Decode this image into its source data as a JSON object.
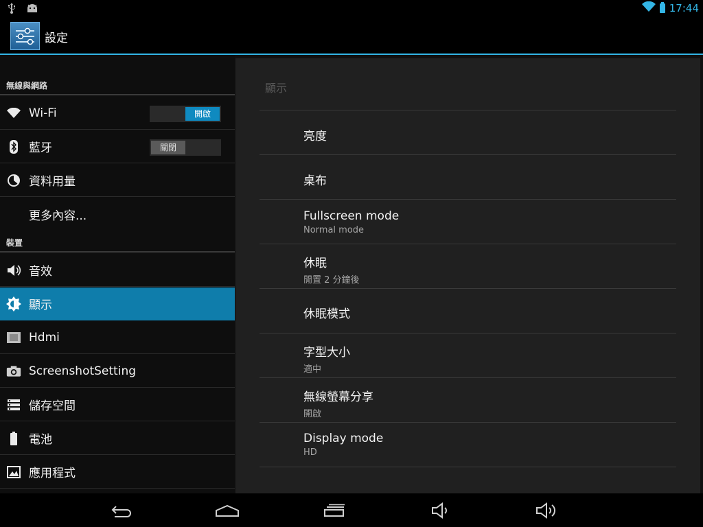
{
  "status_bar": {
    "time": "17:44",
    "left_icons": [
      "usb-icon",
      "android-debug-icon"
    ],
    "right_icons": [
      "wifi-icon",
      "battery-icon"
    ],
    "accent": "#33b5e5"
  },
  "action_bar": {
    "title": "設定",
    "icon": "settings-sliders-icon"
  },
  "sidebar": {
    "sections": [
      {
        "header": "無線與網路"
      },
      {
        "header": "裝置"
      }
    ],
    "items": [
      {
        "label": "Wi-Fi",
        "icon": "wifi-icon",
        "toggle": "開啟",
        "toggle_state": "on"
      },
      {
        "label": "藍牙",
        "icon": "bluetooth-icon",
        "toggle": "關閉",
        "toggle_state": "off"
      },
      {
        "label": "資料用量",
        "icon": "data-usage-icon"
      },
      {
        "label": "更多內容..."
      },
      {
        "label": "音效",
        "icon": "speaker-icon"
      },
      {
        "label": "顯示",
        "icon": "brightness-icon",
        "selected": true
      },
      {
        "label": "Hdmi",
        "icon": "hdmi-icon"
      },
      {
        "label": "ScreenshotSetting",
        "icon": "camera-icon"
      },
      {
        "label": "儲存空間",
        "icon": "storage-icon"
      },
      {
        "label": "電池",
        "icon": "battery-icon"
      },
      {
        "label": "應用程式",
        "icon": "apps-icon"
      }
    ],
    "selected_color": "#0f7dab"
  },
  "detail": {
    "title": "顯示",
    "prefs": [
      {
        "title": "亮度"
      },
      {
        "title": "桌布"
      },
      {
        "title": "Fullscreen mode",
        "summary": "Normal mode"
      },
      {
        "title": "休眠",
        "summary": "閒置 2 分鐘後"
      },
      {
        "title": "休眠模式"
      },
      {
        "title": "字型大小",
        "summary": "適中"
      },
      {
        "title": "無線螢幕分享",
        "summary": "開啟"
      },
      {
        "title": "Display mode",
        "summary": "HD"
      }
    ]
  },
  "nav_bar": {
    "buttons": [
      "back-icon",
      "home-icon",
      "recent-apps-icon",
      "volume-down-icon",
      "volume-up-icon"
    ]
  }
}
